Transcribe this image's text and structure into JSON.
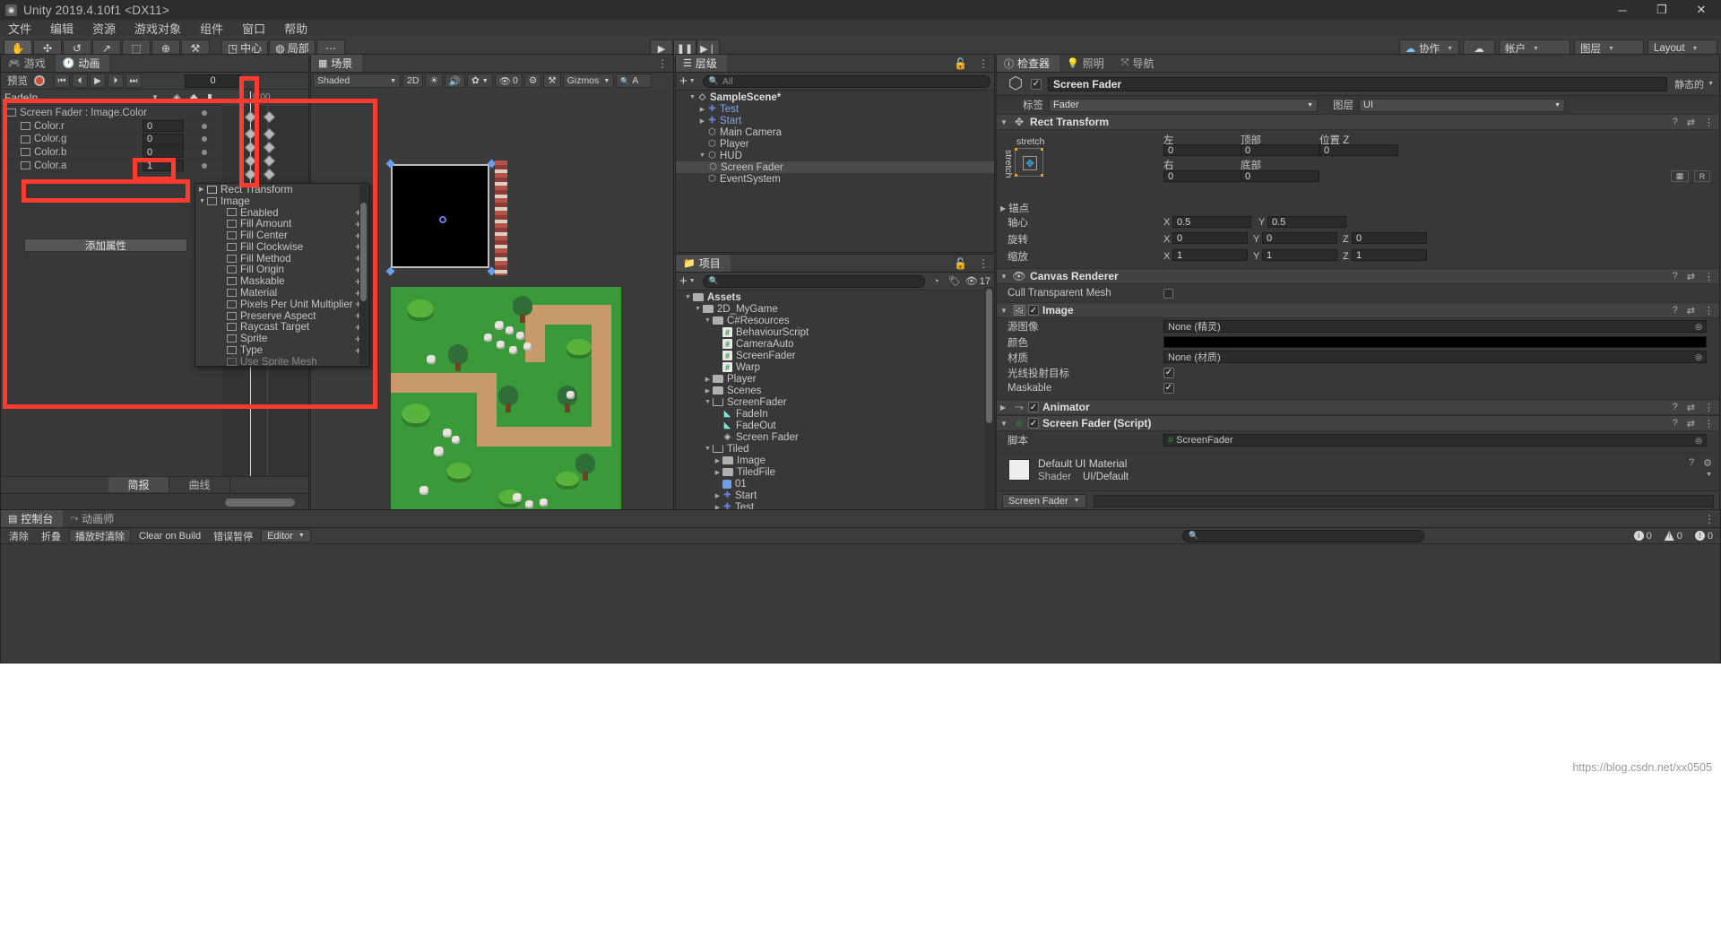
{
  "window": {
    "title": "Unity 2019.4.10f1 <DX11>",
    "app_icon": "unity-icon",
    "buttons": {
      "minimize": "─",
      "maximize": "❐",
      "close": "✕"
    }
  },
  "menubar": {
    "items": [
      "文件",
      "编辑",
      "资源",
      "游戏对象",
      "组件",
      "窗口",
      "帮助"
    ]
  },
  "toolbar": {
    "tools": [
      {
        "name": "hand-tool",
        "glyph": "✋",
        "active": true
      },
      {
        "name": "move-tool",
        "glyph": "✣",
        "active": false
      },
      {
        "name": "rotate-tool",
        "glyph": "↺",
        "active": false
      },
      {
        "name": "scale-tool",
        "glyph": "↗",
        "active": false
      },
      {
        "name": "rect-tool",
        "glyph": "⬚",
        "active": false
      },
      {
        "name": "transform-tool",
        "glyph": "⊕",
        "active": false
      },
      {
        "name": "custom-tool",
        "glyph": "⚒",
        "active": false
      }
    ],
    "pivot_label": "中心",
    "space_label": "局部",
    "grid_label": "⋯",
    "play": "▶",
    "pause": "❚❚",
    "step": "▶❘",
    "collab_label": "协作",
    "cloud_label": "☁",
    "account_label": "帐户",
    "layers_label": "图层",
    "layout_label": "Layout"
  },
  "animation_panel": {
    "tabs": [
      {
        "label": "游戏",
        "icon": "gamepad-icon",
        "selected": false
      },
      {
        "label": "动画",
        "icon": "clock-icon",
        "selected": true
      }
    ],
    "preview_label": "预览",
    "record_icon": "record-icon",
    "transport": [
      "⏮",
      "⏴",
      "▶",
      "⏵",
      "⏭"
    ],
    "frame_value": "0",
    "clip_name": "FadeIn",
    "timeline_label": "0:00",
    "properties": [
      {
        "label": "Screen Fader : Image.Color",
        "value": "",
        "depth": 0
      },
      {
        "label": "Color.r",
        "value": "0",
        "depth": 1
      },
      {
        "label": "Color.g",
        "value": "0",
        "depth": 1
      },
      {
        "label": "Color.b",
        "value": "0",
        "depth": 1
      },
      {
        "label": "Color.a",
        "value": "1",
        "depth": 1
      }
    ],
    "add_property_label": "添加属性",
    "bottom_tabs": [
      {
        "label": "简报",
        "selected": true
      },
      {
        "label": "曲线",
        "selected": false
      }
    ]
  },
  "property_picker": {
    "groups": [
      {
        "label": "Rect Transform",
        "expanded": false,
        "icon": "rect-transform-icon",
        "children": []
      },
      {
        "label": "Image",
        "expanded": true,
        "icon": "image-icon",
        "children": [
          "Enabled",
          "Fill Amount",
          "Fill Center",
          "Fill Clockwise",
          "Fill Method",
          "Fill Origin",
          "Maskable",
          "Material",
          "Pixels Per Unit Multiplier",
          "Preserve Aspect",
          "Raycast Target",
          "Sprite",
          "Type",
          "Use Sprite Mesh"
        ]
      }
    ],
    "add_glyph": "+"
  },
  "scene_panel": {
    "tab_label": "场景",
    "tab_icon": "grid-icon",
    "shading_label": "Shaded",
    "mode_2d": "2D",
    "light_icon": "light-icon",
    "audio_icon": "audio-icon",
    "fx_icon": "fx-icon",
    "effects_count": "0",
    "gizmos_label": "Gizmos",
    "search_placeholder": "A"
  },
  "hierarchy_panel": {
    "tab_label": "层级",
    "tab_icon": "hierarchy-icon",
    "create_label": "+",
    "search_placeholder": "All",
    "items": [
      {
        "label": "SampleScene*",
        "depth": 0,
        "arrow": "▼",
        "icon": "scene-icon",
        "bold": true,
        "selected": false,
        "prefab": false
      },
      {
        "label": "Test",
        "depth": 1,
        "arrow": "▶",
        "icon": "prefab-icon",
        "bold": false,
        "selected": false,
        "prefab": true
      },
      {
        "label": "Start",
        "depth": 1,
        "arrow": "▶",
        "icon": "prefab-icon",
        "bold": false,
        "selected": false,
        "prefab": true
      },
      {
        "label": "Main Camera",
        "depth": 1,
        "arrow": "",
        "icon": "gameobject-icon",
        "bold": false,
        "selected": false,
        "prefab": false
      },
      {
        "label": "Player",
        "depth": 1,
        "arrow": "",
        "icon": "gameobject-icon",
        "bold": false,
        "selected": false,
        "prefab": false
      },
      {
        "label": "HUD",
        "depth": 1,
        "arrow": "▼",
        "icon": "gameobject-icon",
        "bold": false,
        "selected": false,
        "prefab": false
      },
      {
        "label": "Screen Fader",
        "depth": 2,
        "arrow": "",
        "icon": "gameobject-icon",
        "bold": false,
        "selected": true,
        "prefab": false
      },
      {
        "label": "EventSystem",
        "depth": 1,
        "arrow": "",
        "icon": "gameobject-icon",
        "bold": false,
        "selected": false,
        "prefab": false
      }
    ]
  },
  "project_panel": {
    "tab_label": "项目",
    "tab_icon": "folder-icon",
    "create_label": "+",
    "search_placeholder": "",
    "visibility_count": "17",
    "items": [
      {
        "label": "Assets",
        "depth": 0,
        "arrow": "▼",
        "kind": "folder",
        "bold": true
      },
      {
        "label": "2D_MyGame",
        "depth": 1,
        "arrow": "▼",
        "kind": "folder",
        "bold": false
      },
      {
        "label": "C#Resources",
        "depth": 2,
        "arrow": "▼",
        "kind": "folder",
        "bold": false
      },
      {
        "label": "BehaviourScript",
        "depth": 3,
        "arrow": "",
        "kind": "script",
        "bold": false
      },
      {
        "label": "CameraAuto",
        "depth": 3,
        "arrow": "",
        "kind": "script",
        "bold": false
      },
      {
        "label": "ScreenFader",
        "depth": 3,
        "arrow": "",
        "kind": "script",
        "bold": false
      },
      {
        "label": "Warp",
        "depth": 3,
        "arrow": "",
        "kind": "script",
        "bold": false
      },
      {
        "label": "Player",
        "depth": 2,
        "arrow": "▶",
        "kind": "folder",
        "bold": false
      },
      {
        "label": "Scenes",
        "depth": 2,
        "arrow": "▶",
        "kind": "folder",
        "bold": false
      },
      {
        "label": "ScreenFader",
        "depth": 2,
        "arrow": "▼",
        "kind": "folder-open",
        "bold": false
      },
      {
        "label": "FadeIn",
        "depth": 3,
        "arrow": "",
        "kind": "animation",
        "bold": false
      },
      {
        "label": "FadeOut",
        "depth": 3,
        "arrow": "",
        "kind": "animation",
        "bold": false
      },
      {
        "label": "Screen Fader",
        "depth": 3,
        "arrow": "",
        "kind": "controller",
        "bold": false
      },
      {
        "label": "Tiled",
        "depth": 2,
        "arrow": "▼",
        "kind": "folder-open",
        "bold": false
      },
      {
        "label": "Image",
        "depth": 3,
        "arrow": "▶",
        "kind": "folder",
        "bold": false
      },
      {
        "label": "TiledFile",
        "depth": 3,
        "arrow": "▶",
        "kind": "folder",
        "bold": false
      },
      {
        "label": "01",
        "depth": 3,
        "arrow": "",
        "kind": "tilemap",
        "bold": false
      },
      {
        "label": "Start",
        "depth": 3,
        "arrow": "▶",
        "kind": "prefab",
        "bold": false
      },
      {
        "label": "Test",
        "depth": 3,
        "arrow": "▶",
        "kind": "prefab",
        "bold": false
      }
    ]
  },
  "inspector": {
    "tabs": [
      {
        "label": "检查器",
        "icon": "info-icon",
        "selected": true
      },
      {
        "label": "照明",
        "icon": "light-icon",
        "selected": false
      },
      {
        "label": "导航",
        "icon": "nav-icon",
        "selected": false
      }
    ],
    "object_name": "Screen Fader",
    "object_enabled": true,
    "static_label": "静态的",
    "tag_label": "标签",
    "tag_value": "Fader",
    "layer_label": "图层",
    "layer_value": "UI",
    "rect_transform": {
      "title": "Rect Transform",
      "preset_label": "stretch",
      "preset_label_v": "stretch",
      "left_label": "左",
      "left_value": "0",
      "top_label": "顶部",
      "top_value": "0",
      "posz_label": "位置 Z",
      "posz_value": "0",
      "right_label": "右",
      "right_value": "0",
      "bottom_label": "底部",
      "bottom_value": "0",
      "blueprint_label": "▦",
      "raw_label": "R",
      "anchors_label": "锚点",
      "pivot_label": "轴心",
      "pivot_x": "0.5",
      "pivot_y": "0.5",
      "rotation_label": "旋转",
      "rot_x": "0",
      "rot_y": "0",
      "rot_z": "0",
      "scale_label": "缩放",
      "scale_x": "1",
      "scale_y": "1",
      "scale_z": "1",
      "axis_x": "X",
      "axis_y": "Y",
      "axis_z": "Z"
    },
    "canvas_renderer": {
      "title": "Canvas Renderer",
      "cull_label": "Cull Transparent Mesh",
      "cull_checked": false
    },
    "image": {
      "title": "Image",
      "enabled": true,
      "source_label": "源图像",
      "source_value": "None (精灵)",
      "color_label": "颜色",
      "material_label": "材质",
      "material_value": "None (材质)",
      "raycast_label": "光线投射目标",
      "raycast_checked": true,
      "maskable_label": "Maskable",
      "maskable_checked": true
    },
    "animator": {
      "title": "Animator",
      "enabled": true
    },
    "script": {
      "title": "Screen Fader (Script)",
      "enabled": true,
      "script_label": "脚本",
      "script_value": "ScreenFader"
    },
    "material_block": {
      "name": "Default UI Material",
      "shader_label": "Shader",
      "shader_value": "UI/Default"
    },
    "footer_label": "Screen Fader"
  },
  "console_panel": {
    "tabs": [
      {
        "label": "控制台",
        "icon": "console-icon",
        "selected": true
      },
      {
        "label": "动画师",
        "icon": "animator-icon",
        "selected": false
      }
    ],
    "clear_label": "清除",
    "collapse_label": "折叠",
    "clear_on_play_label": "播放时清除",
    "clear_on_build_label": "Clear on Build",
    "error_pause_label": "错误暂停",
    "editor_label": "Editor",
    "search_placeholder": "",
    "counts": {
      "log": "0",
      "warning": "0",
      "error": "0"
    }
  },
  "watermark": "https://blog.csdn.net/xx0505",
  "colors": {
    "accent_red": "#ff3b30",
    "panel_bg": "#383838",
    "header_bg": "#3c3c3c",
    "selection": "#4a4a4a",
    "prefab_blue": "#7fa7e8"
  }
}
